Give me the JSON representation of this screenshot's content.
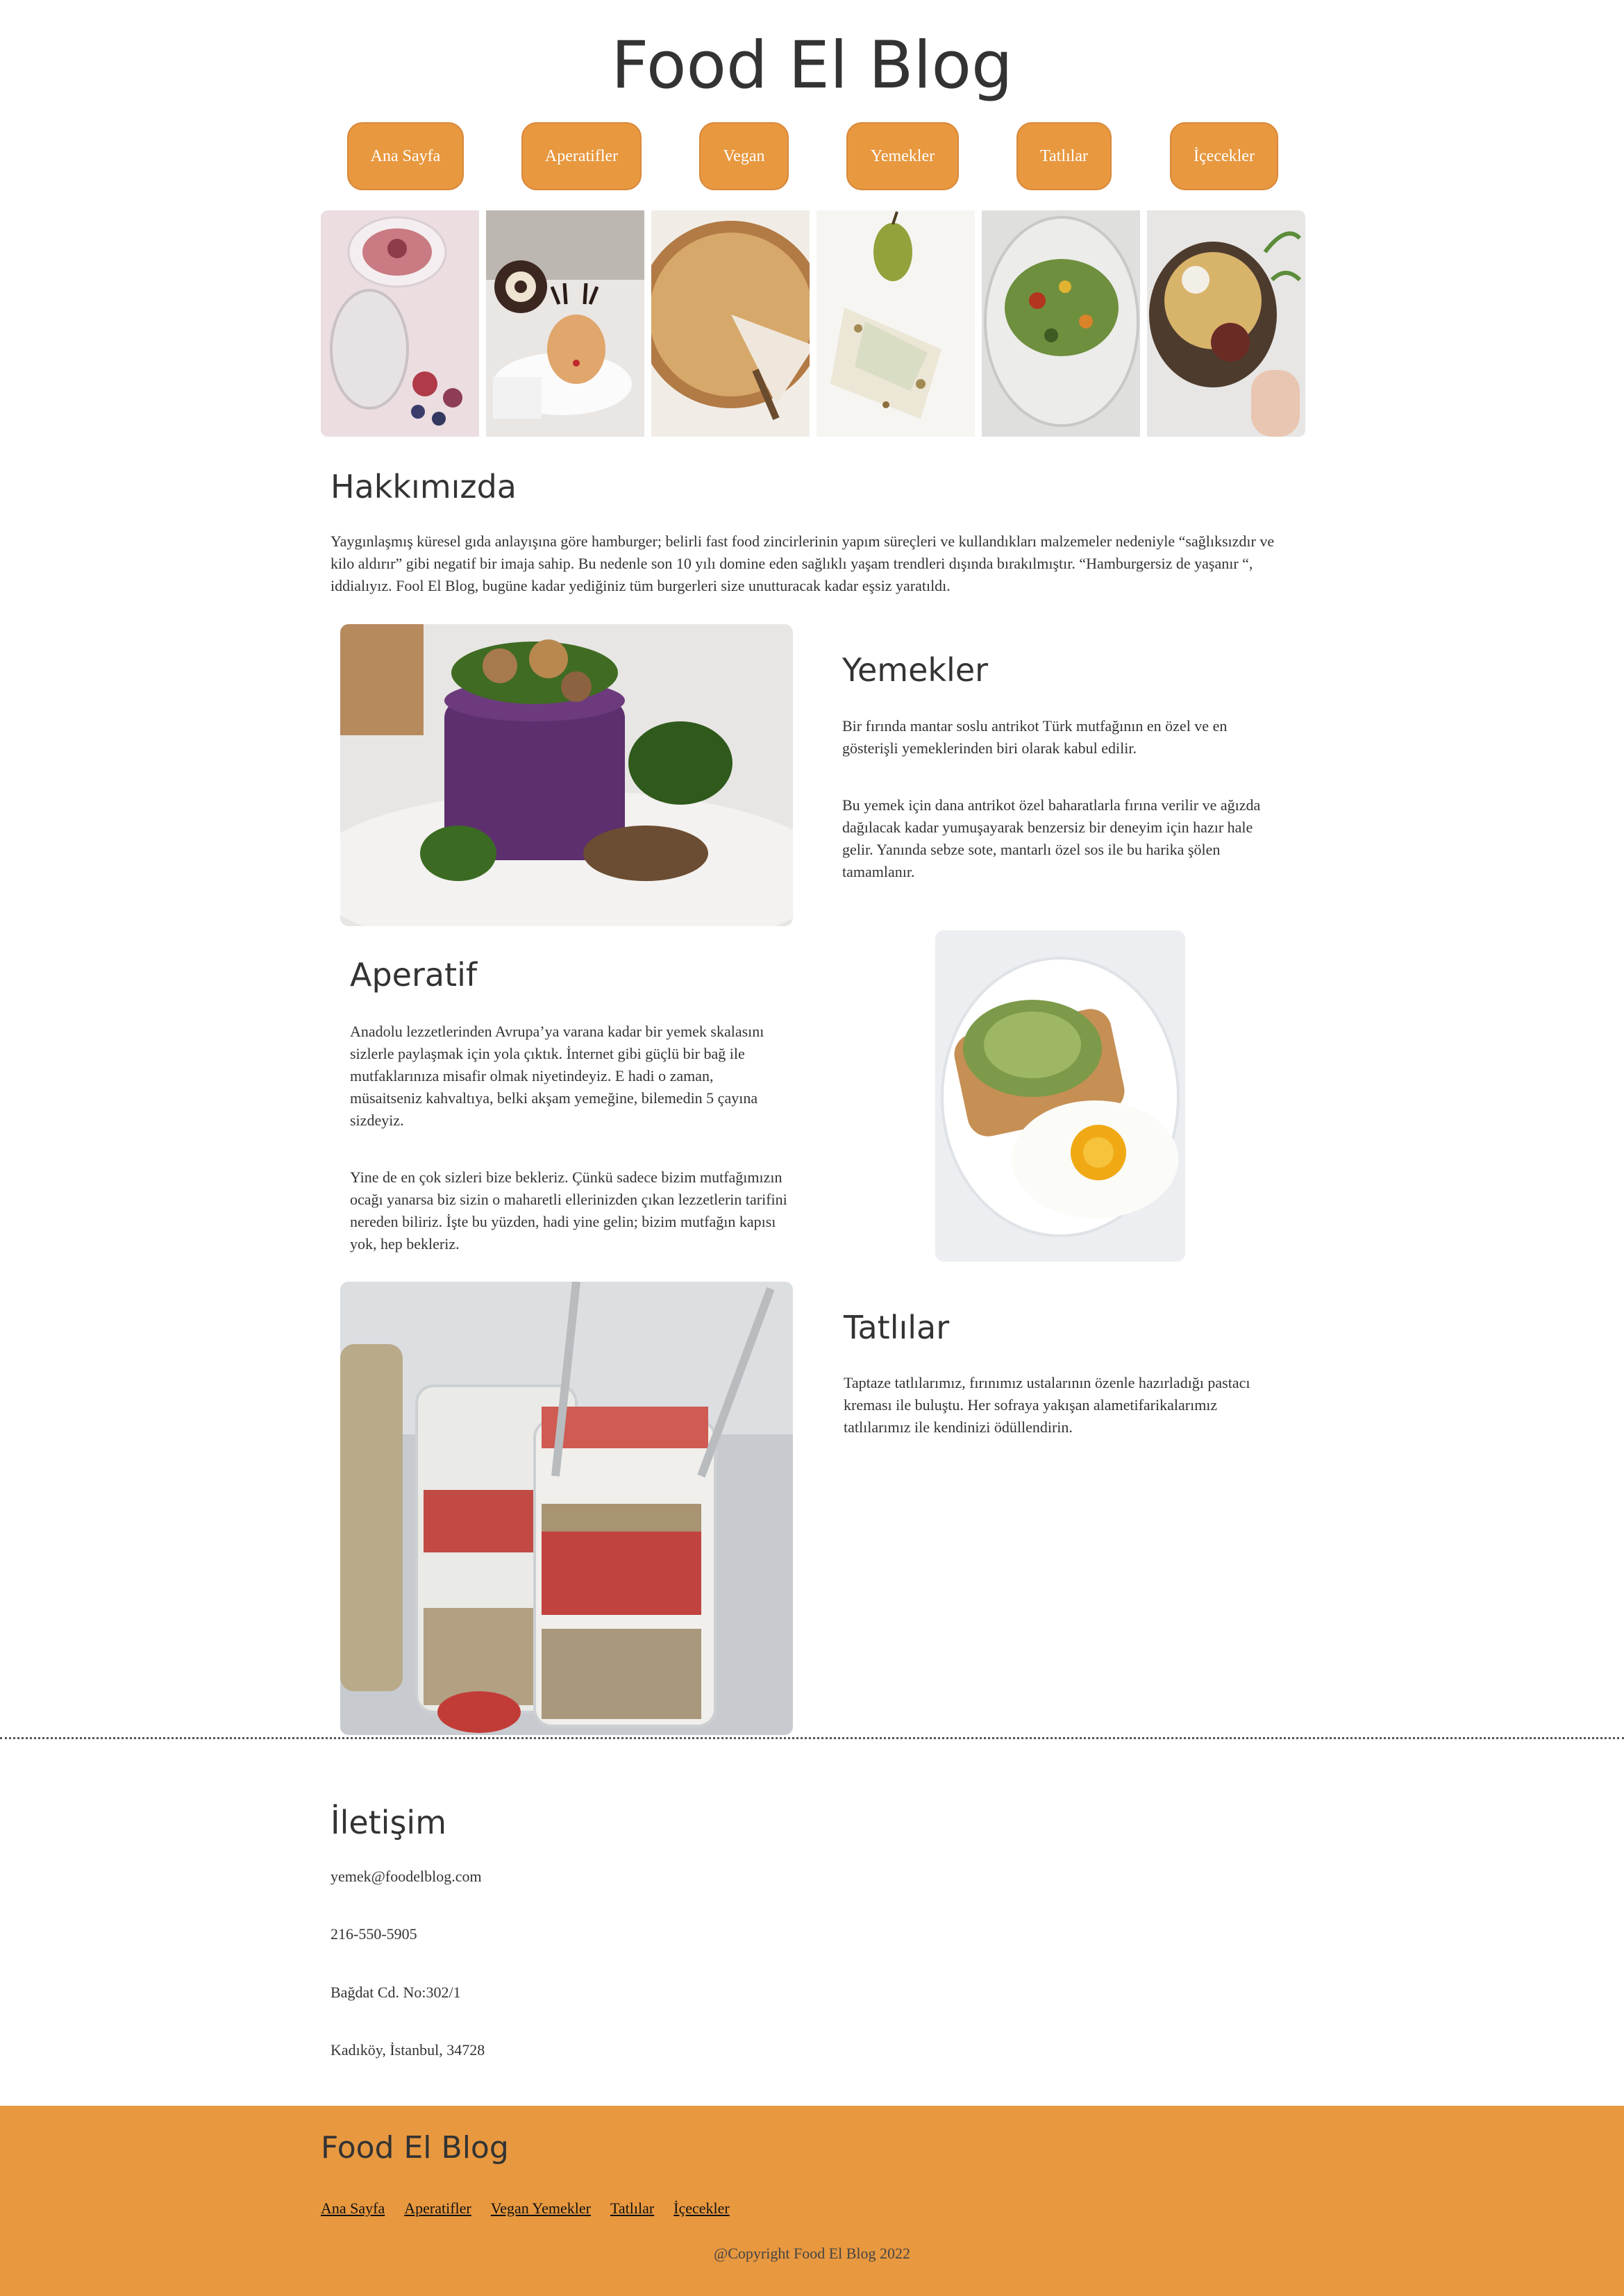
{
  "header": {
    "title": "Food El Blog"
  },
  "nav": {
    "items": [
      "Ana Sayfa",
      "Aperatifler",
      "Vegan",
      "Yemekler",
      "Tatlılar",
      "İçecekler"
    ],
    "color": "#E8983F"
  },
  "gallery": {
    "images": [
      "chia-pudding-figs-photo",
      "cake-roll-reindeer-dessert-photo",
      "pumpkin-pie-photo",
      "pear-dessert-plate-photo",
      "salad-glass-bowl-photo",
      "salad-bowl-hand-photo"
    ]
  },
  "about": {
    "heading": "Hakkımızda",
    "text": "Yaygınlaşmış küresel gıda anlayışına göre hamburger; belirli fast food zincirlerinin yapım süreçleri ve kullandıkları malzemeler nedeniyle “sağlıksızdır ve kilo aldırır” gibi negatif bir imaja sahip. Bu nedenle son 10 yılı domine eden sağlıklı yaşam trendleri dışında bırakılmıştır. “Hamburgersiz de yaşanır “, iddialıyız. Fool El Blog, bugüne kadar yediğiniz tüm burgerleri size unutturacak kadar eşsiz yaratıldı."
  },
  "yemekler": {
    "heading": "Yemekler",
    "p1": "Bir fırında mantar soslu antrikot Türk mutfağının en özel ve en gösterişli yemeklerinden biri olarak kabul edilir.",
    "p2": "Bu yemek için dana antrikot özel baharatlarla fırına verilir ve ağızda dağılacak kadar yumuşayarak benzersiz bir deneyim için hazır hale gelir. Yanında sebze sote, mantarlı özel sos ile bu harika şölen tamamlanır."
  },
  "aperatif": {
    "heading": "Aperatif",
    "p1": "Anadolu lezzetlerinden Avrupa’ya varana kadar bir yemek skalasını sizlerle paylaşmak için yola çıktık. İnternet gibi güçlü bir bağ ile mutfaklarınıza misafir olmak niyetindeyiz. E hadi o zaman, müsaitseniz kahvaltıya, belki akşam yemeğine, bilemedin 5 çayına sizdeyiz.",
    "p2": "Yine de en çok sizleri bize bekleriz. Çünkü sadece bizim mutfağımızın ocağı yanarsa biz sizin o maharetli ellerinizden çıkan lezzetlerin tarifini nereden biliriz. İşte bu yüzden, hadi yine gelin; bizim mutfağın kapısı yok, hep bekleriz."
  },
  "tatlilar": {
    "heading": "Tatlılar",
    "p1": "Taptaze tatlılarımız, fırınımız ustalarının özenle hazırladığı pastacı kreması ile buluştu. Her sofraya yakışan alametifarikalarımız tatlılarımız ile kendinizi ödüllendirin."
  },
  "contact": {
    "heading": "İletişim",
    "email": "yemek@foodelblog.com",
    "phone": "216-550-5905",
    "address1": "Bağdat Cd. No:302/1",
    "address2": "Kadıköy, İstanbul, 34728"
  },
  "footer": {
    "title": "Food El Blog",
    "links": [
      "Ana Sayfa",
      "Aperatifler",
      "Vegan Yemekler",
      "Tatlılar",
      "İçecekler"
    ],
    "copyright": "@Copyright Food El Blog 2022"
  }
}
